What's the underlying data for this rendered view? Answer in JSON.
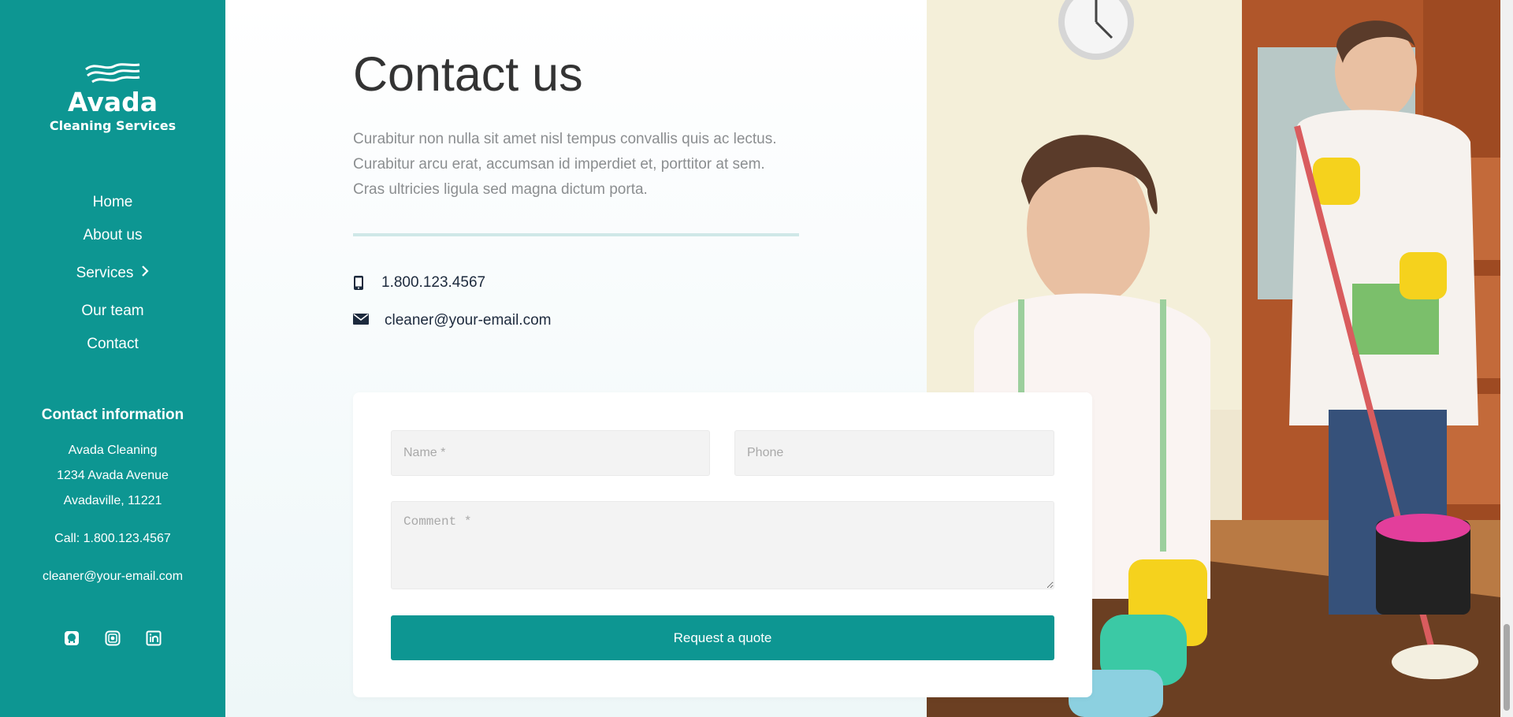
{
  "brand": {
    "name": "Avada",
    "tagline": "Cleaning Services"
  },
  "nav": {
    "items": [
      {
        "label": "Home"
      },
      {
        "label": "About us"
      },
      {
        "label": "Services",
        "submenu_icon": "chevron-right-icon"
      },
      {
        "label": "Our team"
      },
      {
        "label": "Contact"
      }
    ]
  },
  "contact_info": {
    "heading": "Contact information",
    "address": [
      "Avada Cleaning",
      "1234 Avada Avenue",
      "Avadaville, 11221"
    ],
    "call": "Call: 1.800.123.4567",
    "email": "cleaner@your-email.com"
  },
  "social": [
    {
      "icon": "github-icon"
    },
    {
      "icon": "instagram-icon"
    },
    {
      "icon": "linkedin-icon"
    }
  ],
  "main": {
    "title": "Contact us",
    "description": [
      "Curabitur non nulla sit amet nisl tempus convallis quis ac lectus.",
      "Curabitur arcu erat, accumsan id imperdiet et, porttitor at sem.",
      "Cras ultricies ligula sed magna dictum porta."
    ],
    "phone": "1.800.123.4567",
    "email": "cleaner@your-email.com"
  },
  "form": {
    "name_placeholder": "Name *",
    "phone_placeholder": "Phone",
    "comment_placeholder": "Comment *",
    "submit_label": "Request a quote"
  },
  "colors": {
    "accent": "#0d9692",
    "heading": "#333333",
    "body_text": "#8b8e90",
    "divider": "#cfe8e8"
  }
}
